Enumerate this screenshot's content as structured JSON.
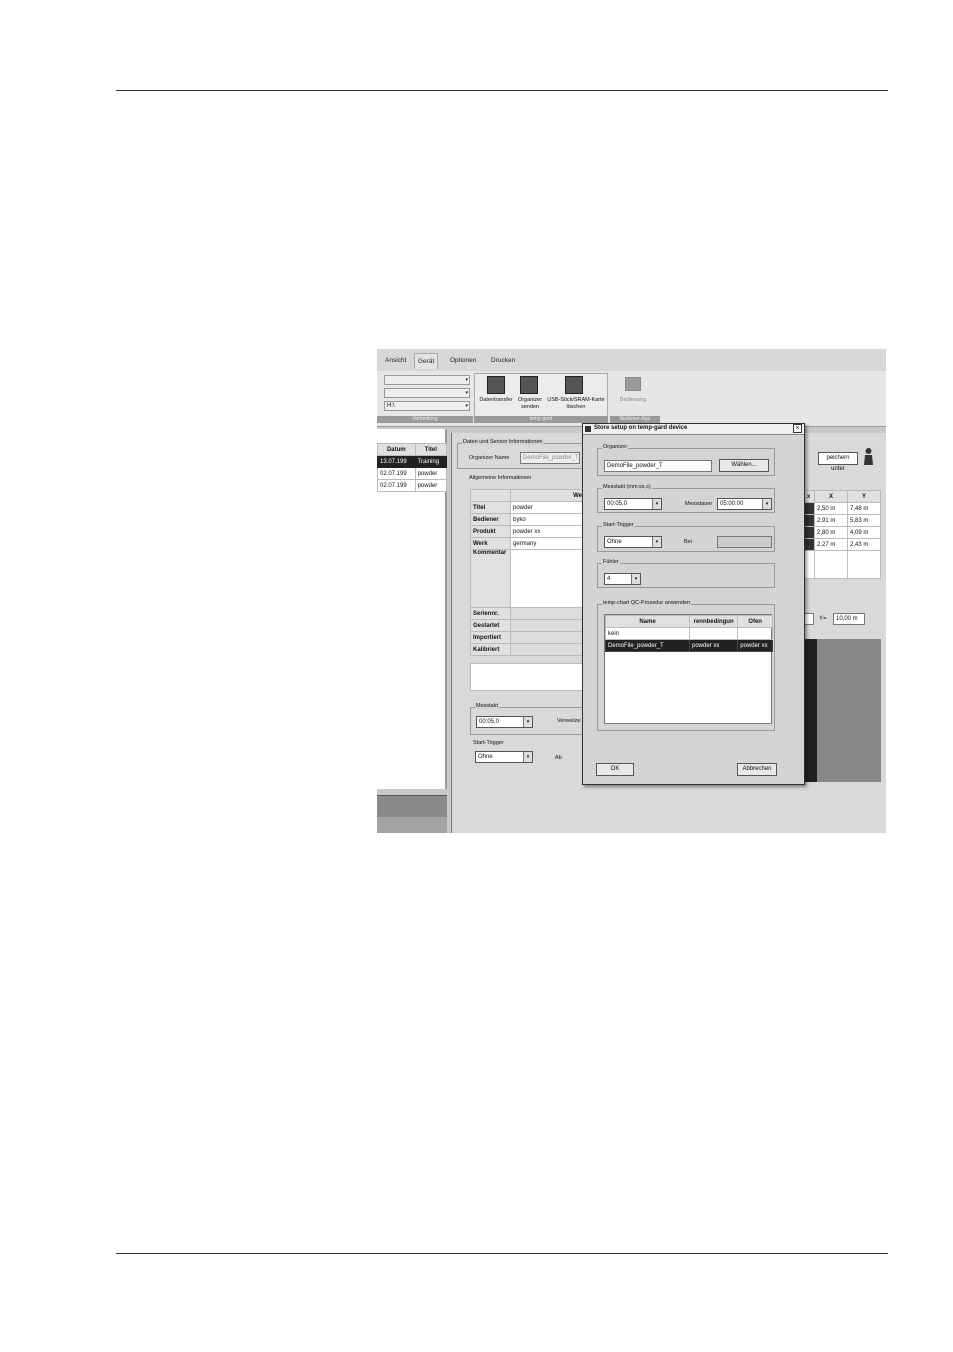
{
  "ribbon": {
    "tabs": [
      "Ansicht",
      "Gerät",
      "Optionen",
      "Drucken"
    ],
    "active_tab": "Gerät",
    "connection_path": "H:\\",
    "buttons": [
      {
        "label": "Datentransfer",
        "icon": "data-transfer-icon"
      },
      {
        "label": "Organizer\nsenden",
        "icon": "organizer-send-icon"
      },
      {
        "label": "USB-Stick/SRAM-Karte\nlöschen",
        "icon": "usb-delete-icon"
      },
      {
        "label": "Bedienung",
        "icon": "operation-icon"
      }
    ],
    "groups": [
      "Verbindung",
      "temp-gard",
      "Bediener-App"
    ]
  },
  "left_list": {
    "headers": [
      "Datum",
      "Titel"
    ],
    "rows": [
      {
        "date": "13.07.199",
        "title": "Training",
        "selected": true
      },
      {
        "date": "02.07.199",
        "title": "powder",
        "selected": false
      },
      {
        "date": "02.07.199",
        "title": "powder",
        "selected": false
      }
    ]
  },
  "background_panel": {
    "section_title": "Daten und Sensor Informationen",
    "organizer_label": "Organizer Name",
    "organizer_value": "DemoFile_powder_T",
    "general_info_title": "Allgemeine Informationen",
    "table_value_header": "We",
    "rows": [
      {
        "label": "Titel",
        "value": "powder"
      },
      {
        "label": "Bediener",
        "value": "byko"
      },
      {
        "label": "Produkt",
        "value": "powder xx"
      },
      {
        "label": "Werk",
        "value": "germany"
      },
      {
        "label": "Kommentar",
        "value": ""
      }
    ],
    "rows2": [
      "Seriennr.",
      "Gestartet",
      "Importiert",
      "Kalibriert"
    ],
    "messtakt_label": "Messtakt",
    "messtakt_value": "00:05,0",
    "verweilzeit_label": "Verweilze",
    "start_trigger_label": "Start-Trigger",
    "start_trigger_value": "Ohne",
    "ab_label": "Ab",
    "save_under": "peichern unter",
    "coords": {
      "headers": [
        "x",
        "X",
        "Y"
      ],
      "rows": [
        [
          "",
          "2,50 m",
          "7,48 m"
        ],
        [
          "",
          "2,91 m",
          "5,83 m"
        ],
        [
          "",
          "2,80 m",
          "4,09 m"
        ],
        [
          "",
          "2,27 m",
          "2,43 m"
        ]
      ]
    },
    "y_label": "Y=",
    "y_value": "10,00 m"
  },
  "dialog": {
    "title": "Store setup on temp-gard device",
    "organizer_group": "Organizer",
    "organizer_value": "DemoFile_powder_T",
    "choose_button": "Wählen...",
    "messtakt_group": "Messtakt (mm:ss,s)",
    "messtakt_value": "00:05,0",
    "messdauer_label": "Messdauer",
    "messdauer_value": "05:00:00",
    "start_trigger_group": "Start-Trigger",
    "start_trigger_value": "Ohne",
    "bei_label": "Bei",
    "fuehler_group": "Fühler",
    "fuehler_value": "4",
    "qc_group": "temp-chart QC-Prozedur anwenden",
    "qc_headers": [
      "Name",
      "rennbedingun",
      "Ofen"
    ],
    "qc_rows": [
      {
        "name": "kein",
        "cond": "",
        "oven": "",
        "selected": false
      },
      {
        "name": "DemoFile_powder_T",
        "cond": "powder xx",
        "oven": "powder xx",
        "selected": true
      }
    ],
    "ok_label": "OK",
    "cancel_label": "Abbrechen",
    "close_glyph": "×"
  }
}
